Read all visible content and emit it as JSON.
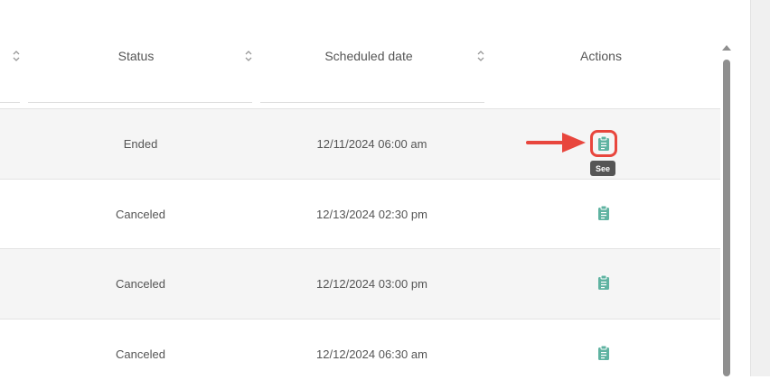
{
  "table": {
    "headers": {
      "status": "Status",
      "scheduled_date": "Scheduled date",
      "actions": "Actions"
    },
    "rows": [
      {
        "status": "Ended",
        "scheduled_date": "12/11/2024 06:00 am",
        "action_icon": "clipboard-icon"
      },
      {
        "status": "Canceled",
        "scheduled_date": "12/13/2024 02:30 pm",
        "action_icon": "clipboard-icon"
      },
      {
        "status": "Canceled",
        "scheduled_date": "12/12/2024 03:00 pm",
        "action_icon": "clipboard-icon"
      },
      {
        "status": "Canceled",
        "scheduled_date": "12/12/2024 06:30 am",
        "action_icon": "clipboard-icon"
      }
    ]
  },
  "tooltip": {
    "label": "See"
  },
  "colors": {
    "action_icon": "#5fb3a1",
    "highlight": "#e8463d",
    "arrow": "#e8463d",
    "row_alt": "#f5f5f5",
    "tooltip_bg": "#555555"
  },
  "icons": {
    "sort": "sort-arrows-icon",
    "annotation": "red-arrow-icon"
  }
}
